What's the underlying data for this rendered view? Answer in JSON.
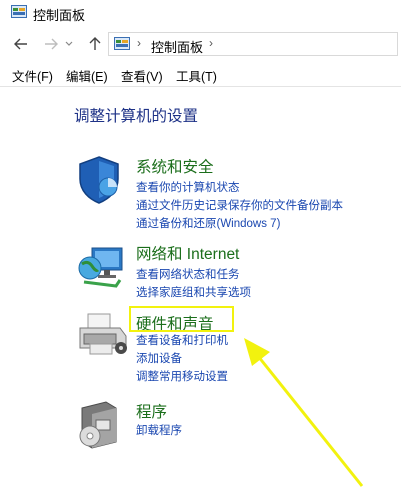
{
  "window": {
    "title": "控制面板"
  },
  "nav": {
    "breadcrumb": "控制面板",
    "separator": "›"
  },
  "menu": [
    "文件(F)",
    "编辑(E)",
    "查看(V)",
    "工具(T)"
  ],
  "heading": "调整计算机的设置",
  "categories": [
    {
      "title": "系统和安全",
      "links": [
        "查看你的计算机状态",
        "通过文件历史记录保存你的文件备份副本",
        "通过备份和还原(Windows 7)"
      ]
    },
    {
      "title": "网络和 Internet",
      "links": [
        "查看网络状态和任务",
        "选择家庭组和共享选项"
      ]
    },
    {
      "title": "硬件和声音",
      "links": [
        "查看设备和打印机",
        "添加设备",
        "调整常用移动设置"
      ]
    },
    {
      "title": "程序",
      "links": [
        "卸载程序"
      ]
    }
  ],
  "colors": {
    "link": "#1a47b0",
    "category_title": "#1b6e1b",
    "heading": "#1e3287",
    "highlight": "#f2f20e"
  },
  "icons": [
    "control-panel-icon",
    "back-arrow-icon",
    "forward-arrow-icon",
    "recent-dropdown-icon",
    "up-arrow-icon",
    "shield-icon",
    "network-globe-icon",
    "printer-icon",
    "programs-icon"
  ]
}
